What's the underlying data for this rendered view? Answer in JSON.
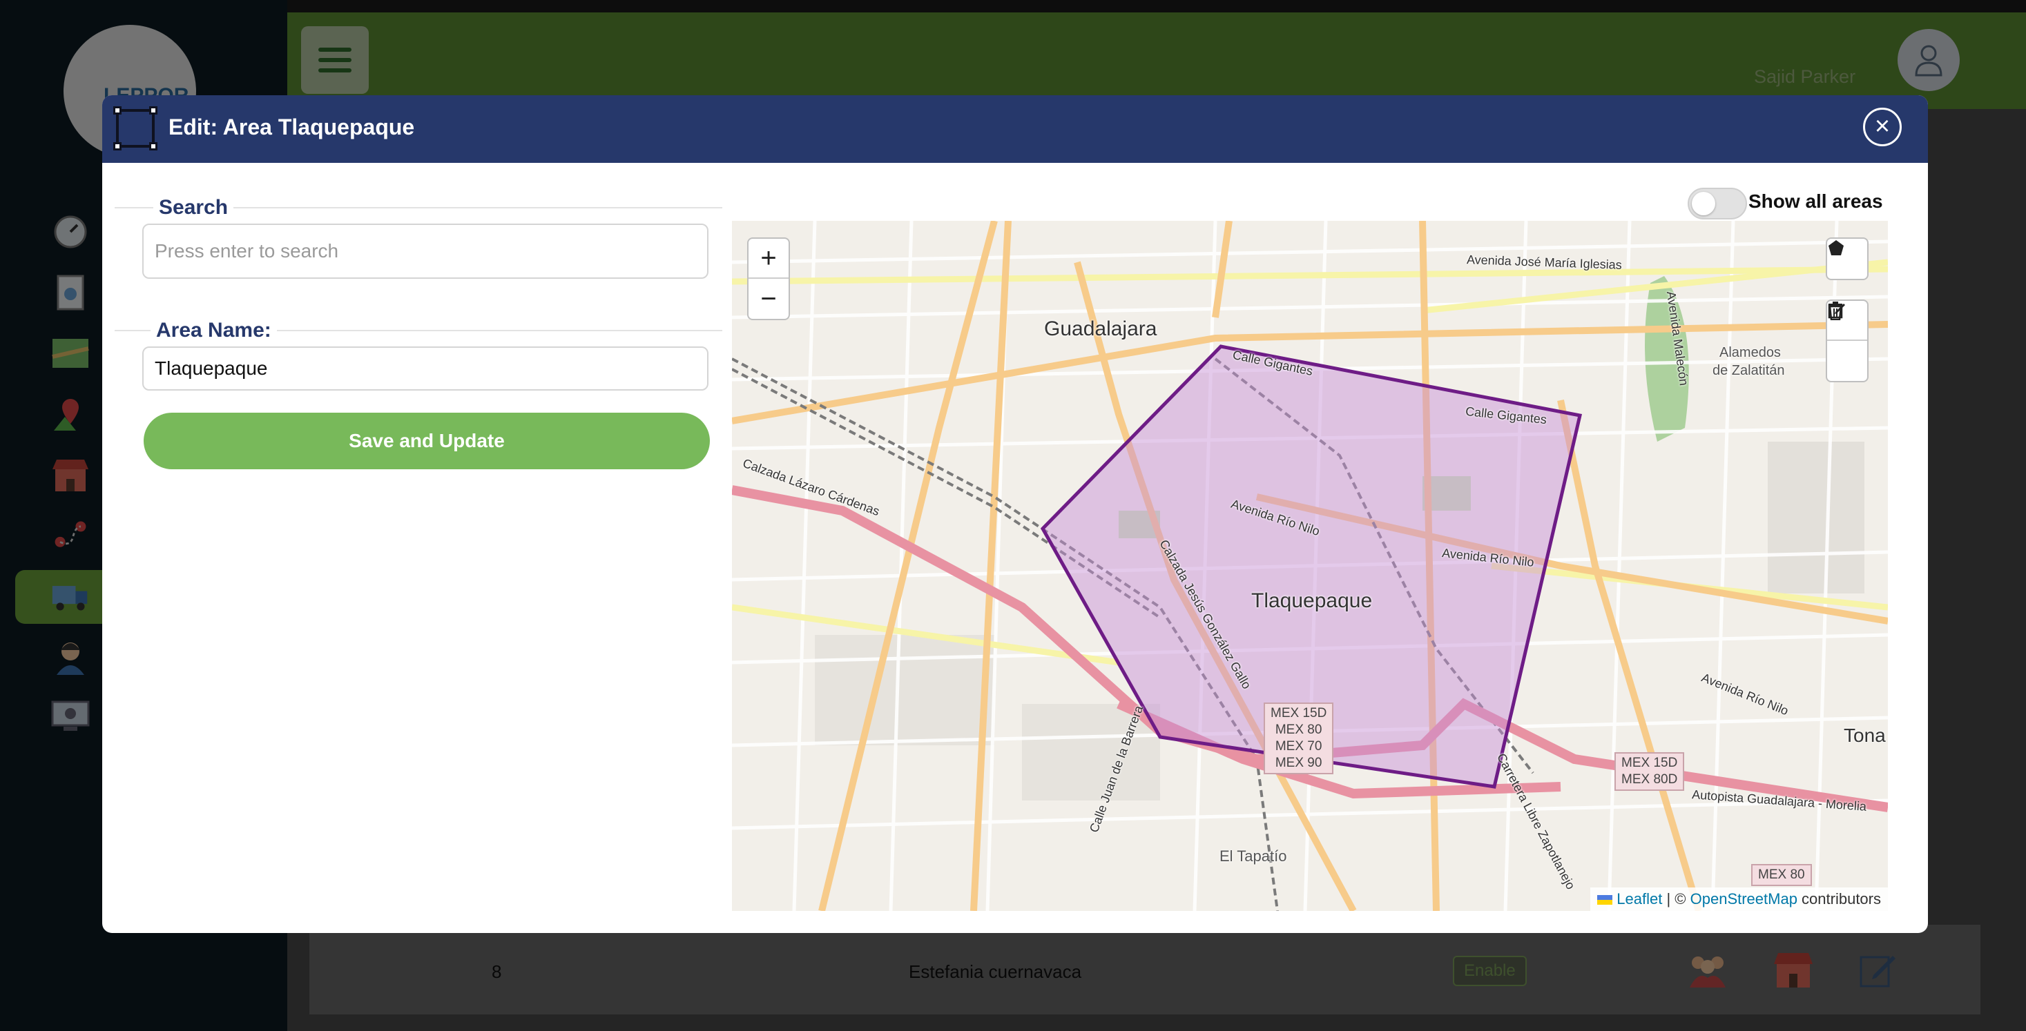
{
  "app": {
    "logo_text": "LEPPOR",
    "user_name": "Sajid Parker",
    "sidebar_icons": [
      "dashboard-icon",
      "document-icon",
      "map-icon",
      "location-pin-icon",
      "store-icon",
      "route-icon",
      "truck-icon",
      "person-icon",
      "settings-screen-icon"
    ],
    "table_row": {
      "number": "8",
      "name": "Estefania cuernavaca",
      "status": "Enable"
    }
  },
  "modal": {
    "title": "Edit: Area Tlaquepaque",
    "close_label": "×",
    "search": {
      "label": "Search",
      "placeholder": "Press enter to search",
      "value": ""
    },
    "area_name": {
      "label": "Area Name:",
      "value": "Tlaquepaque"
    },
    "save_label": "Save and Update",
    "toggle": {
      "label": "Show all areas",
      "checked": false
    }
  },
  "map": {
    "zoom_in": "+",
    "zoom_out": "−",
    "labels": {
      "guadalajara": "Guadalajara",
      "tlaquepaque": "Tlaquepaque",
      "tona": "Tona",
      "alamedos": "Alamedos",
      "de_zalatitan": "de Zalatitán",
      "el_tapatio": "El Tapatío",
      "calle_gigantes_1": "Calle Gigantes",
      "calle_gigantes_2": "Calle Gigantes",
      "avenida_rio_nilo_1": "Avenida Río Nilo",
      "avenida_rio_nilo_2": "Avenida Río Nilo",
      "avenida_rio_nilo_3": "Avenida Río Nilo",
      "avenida_jose_maria_iglesias": "Avenida José María Iglesias",
      "calzada_lazaro_cardenas": "Calzada Lázaro Cárdenas",
      "calzada_jesus_gonzalez_gallo": "Calzada Jesús González Gallo",
      "calle_juan_de_la_barrera": "Calle Juan de la Barrera",
      "carretera_libre_zapotlanejo": "Carretera Libre Zapotlanejo",
      "autopista_guadalajara_morelia": "Autopista Guadalajara - Morelia",
      "avenida_malecon": "Avenida Malecón"
    },
    "shields": {
      "main": [
        "MEX 15D",
        "MEX 80",
        "MEX 70",
        "MEX 90"
      ],
      "east": [
        "MEX 15D",
        "MEX 80D"
      ],
      "south": [
        "MEX 80"
      ]
    },
    "attribution": {
      "leaflet": "Leaflet",
      "separator": " | © ",
      "osm": "OpenStreetMap",
      "contributors": " contributors"
    },
    "polygon_color": "#6e1c86",
    "polygon_fill": "#c58bd6"
  }
}
